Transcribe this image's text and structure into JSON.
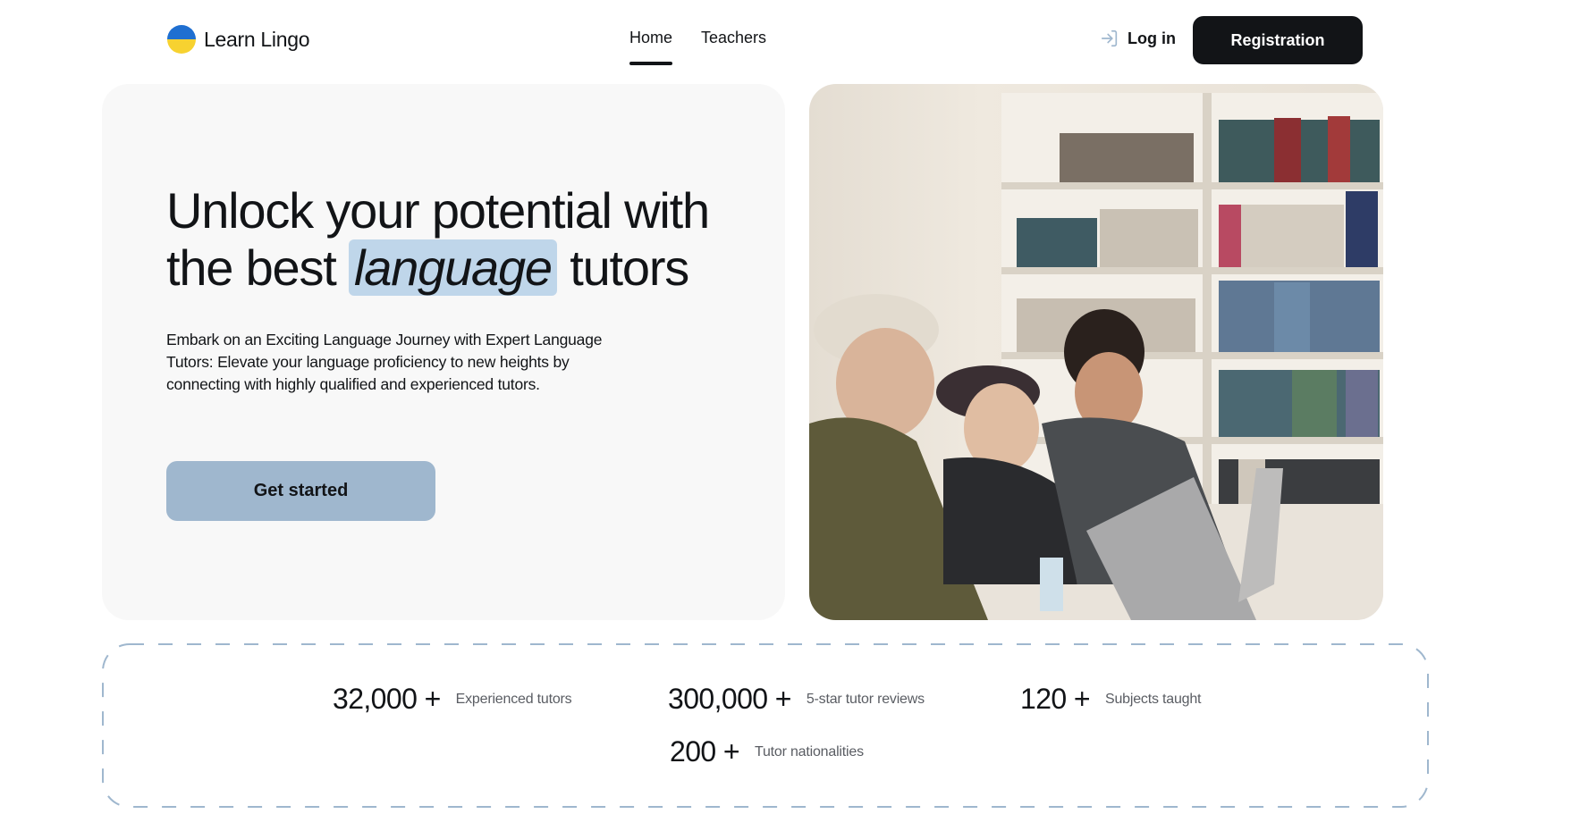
{
  "brand": {
    "name": "Learn Lingo",
    "flag_colors": [
      "#1f6fd1",
      "#f7d230"
    ]
  },
  "nav": {
    "items": [
      {
        "label": "Home",
        "active": true
      },
      {
        "label": "Teachers",
        "active": false
      }
    ]
  },
  "auth": {
    "login_label": "Log in",
    "register_label": "Registration"
  },
  "hero": {
    "title_part1": "Unlock your potential with the best",
    "title_highlight": "language",
    "title_part2": "tutors",
    "subtitle": "Embark on an Exciting Language Journey with Expert Language Tutors: Elevate your language proficiency to new heights by connecting with highly qualified and experienced tutors.",
    "cta_label": "Get started",
    "image_description": "people-at-laptop-in-library-photo"
  },
  "stats": [
    {
      "value": "32,000 +",
      "label": "Experienced tutors"
    },
    {
      "value": "300,000 +",
      "label": "5-star tutor reviews"
    },
    {
      "value": "120 +",
      "label": "Subjects taught"
    },
    {
      "value": "200 +",
      "label": "Tutor nationalities"
    }
  ],
  "colors": {
    "accent": "#9fb7ce",
    "highlight": "#bfd6ea",
    "dark": "#121417",
    "card_bg": "#f8f8f8",
    "stats_border": "#9fb7ce"
  }
}
